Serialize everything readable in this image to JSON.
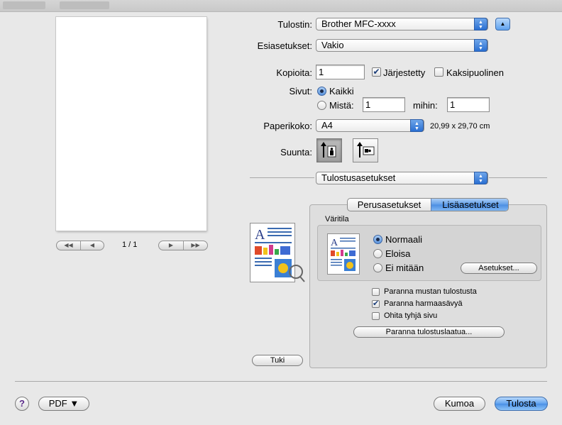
{
  "window": {
    "preview_page": "1 / 1"
  },
  "printer": {
    "label": "Tulostin:",
    "value": "Brother MFC-xxxx"
  },
  "presets": {
    "label": "Esiasetukset:",
    "value": "Vakio"
  },
  "copies": {
    "label": "Kopioita:",
    "value": "1",
    "collated_label": "Järjestetty",
    "collated": true,
    "duplex_label": "Kaksipuolinen",
    "duplex": false
  },
  "pages": {
    "label": "Sivut:",
    "all_label": "Kaikki",
    "from_label": "Mistä:",
    "from_value": "1",
    "to_label": "mihin:",
    "to_value": "1",
    "selected": "all"
  },
  "paper": {
    "label": "Paperikoko:",
    "value": "A4",
    "dimensions": "20,99 x 29,70 cm"
  },
  "orientation": {
    "label": "Suunta:"
  },
  "panel": {
    "value": "Tulostusasetukset"
  },
  "tabs": [
    {
      "label": "Perusasetukset"
    },
    {
      "label": "Lisäasetukset"
    }
  ],
  "color_mode": {
    "group_label": "Väritila",
    "options": [
      {
        "label": "Normaali",
        "selected": true
      },
      {
        "label": "Eloisa",
        "selected": false
      },
      {
        "label": "Ei mitään",
        "selected": false
      }
    ],
    "settings_button": "Asetukset..."
  },
  "options": [
    {
      "label": "Paranna mustan tulostusta",
      "checked": false
    },
    {
      "label": "Paranna harmaasävyä",
      "checked": true
    },
    {
      "label": "Ohita tyhjä sivu",
      "checked": false
    }
  ],
  "improve_quality_button": "Paranna tulostuslaatua...",
  "support_button": "Tuki",
  "footer": {
    "help": "?",
    "pdf": "PDF ▼",
    "cancel": "Kumoa",
    "print": "Tulosta"
  },
  "colors": {
    "accent": "#4a90e6",
    "background": "#e8e8e8"
  }
}
